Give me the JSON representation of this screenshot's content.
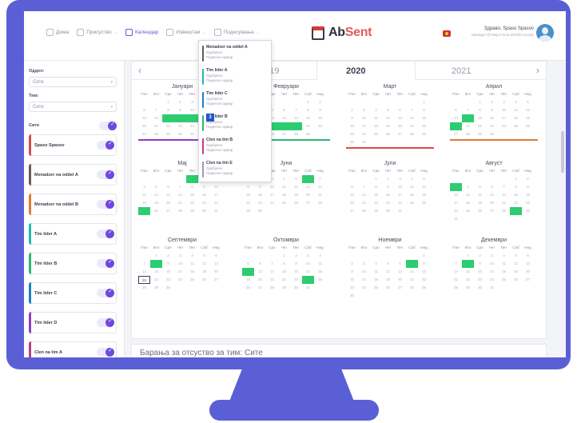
{
  "nav": [
    {
      "label": "Дома",
      "icon": "home-icon",
      "active": false,
      "dropdown": false
    },
    {
      "label": "Присуство",
      "icon": "clock-icon",
      "active": false,
      "dropdown": true
    },
    {
      "label": "Календар",
      "icon": "calendar-icon",
      "active": true,
      "dropdown": false
    },
    {
      "label": "Извештаи",
      "icon": "report-icon",
      "active": false,
      "dropdown": true
    },
    {
      "label": "Подесувања",
      "icon": "settings-icon",
      "active": false,
      "dropdown": true
    }
  ],
  "logo": {
    "part1": "Ab",
    "part2": "Sent"
  },
  "user": {
    "greeting": "Здраво, Spaso Spasov",
    "role": "Manager @ Moja Firma DOOEl Скопје"
  },
  "sidebar": {
    "dept_label": "Оддел:",
    "dept_value": "Сите",
    "team_label": "Тим:",
    "team_value": "Сите",
    "all_label": "Сите",
    "members": [
      {
        "name": "Spaso Spasov",
        "color": "#d94a4a"
      },
      {
        "name": "Menadzer na oddel A",
        "color": "#6b5a4e"
      },
      {
        "name": "Menadzer na oddel B",
        "color": "#e07a35"
      },
      {
        "name": "Tim lider A",
        "color": "#20b8b0"
      },
      {
        "name": "Tim lider B",
        "color": "#2bb673"
      },
      {
        "name": "Tim lider C",
        "color": "#1e7fc7"
      },
      {
        "name": "Tim lider D",
        "color": "#8a3fc2"
      },
      {
        "name": "Clen na tim A",
        "color": "#c23a86"
      }
    ]
  },
  "years": {
    "prev": "2019",
    "current": "2020",
    "next": "2021"
  },
  "dow": [
    "Пон",
    "Вто",
    "Сре",
    "Чет",
    "Пет",
    "Саб",
    "Нед"
  ],
  "months": [
    {
      "name": "Јануари",
      "offset": 2,
      "days": 31,
      "green": [
        15,
        16,
        17,
        18
      ],
      "line": "#8a3fc2"
    },
    {
      "name": "Февруари",
      "offset": 5,
      "days": 29,
      "green": [
        17,
        18,
        19,
        20,
        21
      ],
      "line": "#2bb673"
    },
    {
      "name": "Март",
      "offset": 6,
      "days": 31,
      "green": [],
      "line": "#d94a4a"
    },
    {
      "name": "Април",
      "offset": 2,
      "days": 30,
      "green": [
        14,
        20
      ],
      "line": "#e07a35"
    },
    {
      "name": "Мај",
      "offset": 4,
      "days": 31,
      "green": [
        1,
        25
      ],
      "line": ""
    },
    {
      "name": "Јуни",
      "offset": 0,
      "days": 30,
      "green": [
        6
      ],
      "line": ""
    },
    {
      "name": "Јули",
      "offset": 2,
      "days": 31,
      "green": [],
      "line": ""
    },
    {
      "name": "Август",
      "offset": 5,
      "days": 31,
      "green": [
        3,
        29
      ],
      "line": ""
    },
    {
      "name": "Септември",
      "offset": 1,
      "days": 30,
      "green": [
        8
      ],
      "line": ""
    },
    {
      "name": "Октомври",
      "offset": 3,
      "days": 31,
      "green": [
        12,
        24
      ],
      "line": ""
    },
    {
      "name": "Ноември",
      "offset": 6,
      "days": 30,
      "green": [
        7
      ],
      "line": ""
    },
    {
      "name": "Декември",
      "offset": 1,
      "days": 31,
      "green": [
        8
      ],
      "line": ""
    }
  ],
  "today": {
    "month": 8,
    "day": 21
  },
  "popup": [
    {
      "title": "Menadzer na oddel A",
      "status": "Одобрено",
      "action": "Поднесен одмор",
      "color": "#6b5a4e"
    },
    {
      "title": "Tim lider A",
      "status": "Одобрено",
      "action": "Поднесен одмор",
      "color": "#20b8b0"
    },
    {
      "title": "Tim lider C",
      "status": "Одобрено",
      "action": "Поднесен одмор",
      "color": "#1e7fc7"
    },
    {
      "title": "Tim lider B",
      "status": "Одобрено",
      "action": "Поднесен одмор",
      "color": "#2bb673"
    },
    {
      "title": "Clen na tim B",
      "status": "Одобрено",
      "action": "Поднесен одмор",
      "color": "#c23a86"
    },
    {
      "title": "Clen na tim E",
      "status": "Одобрено",
      "action": "Поднесен одмор",
      "color": "#9a9cae"
    }
  ],
  "badge": "3",
  "requests_title": "Барања за отсуство за тим: Сите"
}
